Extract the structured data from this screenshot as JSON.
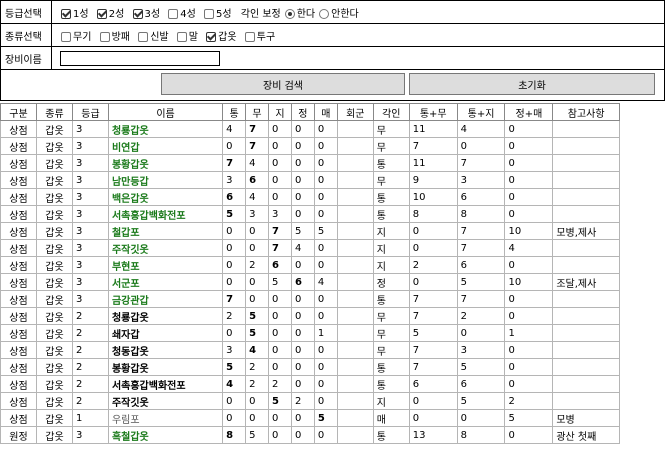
{
  "filters": {
    "grade": {
      "label": "등급선택",
      "options": [
        {
          "label": "1성",
          "checked": true
        },
        {
          "label": "2성",
          "checked": true
        },
        {
          "label": "3성",
          "checked": true
        },
        {
          "label": "4성",
          "checked": false
        },
        {
          "label": "5성",
          "checked": false
        }
      ],
      "engrave": {
        "label": "각인 보정",
        "options": [
          {
            "label": "한다",
            "selected": true
          },
          {
            "label": "안한다",
            "selected": false
          }
        ]
      }
    },
    "type": {
      "label": "종류선택",
      "options": [
        {
          "label": "무기",
          "checked": false
        },
        {
          "label": "방패",
          "checked": false
        },
        {
          "label": "신발",
          "checked": false
        },
        {
          "label": "말",
          "checked": false
        },
        {
          "label": "갑옷",
          "checked": true
        },
        {
          "label": "투구",
          "checked": false
        }
      ]
    },
    "name": {
      "label": "장비이름",
      "value": ""
    }
  },
  "buttons": {
    "search": "장비 검색",
    "reset": "초기화"
  },
  "table": {
    "headers": [
      "구분",
      "종류",
      "등급",
      "이름",
      "통",
      "무",
      "지",
      "정",
      "매",
      "회군",
      "각인",
      "통+무",
      "통+지",
      "정+매",
      "참고사항"
    ],
    "rows": [
      {
        "cells": [
          "상점",
          "갑옷",
          "3",
          "청룡갑옷",
          "4",
          "7",
          "0",
          "0",
          "0",
          "",
          "무",
          "11",
          "4",
          "0",
          ""
        ],
        "name_style": "green",
        "bold": [
          5
        ]
      },
      {
        "cells": [
          "상점",
          "갑옷",
          "3",
          "비연갑",
          "0",
          "7",
          "0",
          "0",
          "0",
          "",
          "무",
          "7",
          "0",
          "0",
          ""
        ],
        "name_style": "green",
        "bold": [
          5
        ]
      },
      {
        "cells": [
          "상점",
          "갑옷",
          "3",
          "봉황갑옷",
          "7",
          "4",
          "0",
          "0",
          "0",
          "",
          "통",
          "11",
          "7",
          "0",
          ""
        ],
        "name_style": "green",
        "bold": [
          4
        ]
      },
      {
        "cells": [
          "상점",
          "갑옷",
          "3",
          "남만등갑",
          "3",
          "6",
          "0",
          "0",
          "0",
          "",
          "무",
          "9",
          "3",
          "0",
          ""
        ],
        "name_style": "green",
        "bold": [
          5
        ]
      },
      {
        "cells": [
          "상점",
          "갑옷",
          "3",
          "백은갑옷",
          "6",
          "4",
          "0",
          "0",
          "0",
          "",
          "통",
          "10",
          "6",
          "0",
          ""
        ],
        "name_style": "green",
        "bold": [
          4
        ]
      },
      {
        "cells": [
          "상점",
          "갑옷",
          "3",
          "서촉홍갑백화전포",
          "5",
          "3",
          "3",
          "0",
          "0",
          "",
          "통",
          "8",
          "8",
          "0",
          ""
        ],
        "name_style": "green",
        "bold": [
          4
        ]
      },
      {
        "cells": [
          "상점",
          "갑옷",
          "3",
          "철갑포",
          "0",
          "0",
          "7",
          "5",
          "5",
          "",
          "지",
          "0",
          "7",
          "10",
          "모병,제사"
        ],
        "name_style": "green",
        "bold": [
          6
        ]
      },
      {
        "cells": [
          "상점",
          "갑옷",
          "3",
          "주작깃옷",
          "0",
          "0",
          "7",
          "4",
          "0",
          "",
          "지",
          "0",
          "7",
          "4",
          ""
        ],
        "name_style": "green",
        "bold": [
          6
        ]
      },
      {
        "cells": [
          "상점",
          "갑옷",
          "3",
          "부현포",
          "0",
          "2",
          "6",
          "0",
          "0",
          "",
          "지",
          "2",
          "6",
          "0",
          ""
        ],
        "name_style": "green",
        "bold": [
          6
        ]
      },
      {
        "cells": [
          "상점",
          "갑옷",
          "3",
          "서군포",
          "0",
          "0",
          "5",
          "6",
          "4",
          "",
          "정",
          "0",
          "5",
          "10",
          "조달,제사"
        ],
        "name_style": "green",
        "bold": [
          7
        ]
      },
      {
        "cells": [
          "상점",
          "갑옷",
          "3",
          "금강관갑",
          "7",
          "0",
          "0",
          "0",
          "0",
          "",
          "통",
          "7",
          "7",
          "0",
          ""
        ],
        "name_style": "green",
        "bold": [
          4
        ]
      },
      {
        "cells": [
          "상점",
          "갑옷",
          "2",
          "청룡갑옷",
          "2",
          "5",
          "0",
          "0",
          "0",
          "",
          "무",
          "7",
          "2",
          "0",
          ""
        ],
        "name_style": "bold",
        "bold": [
          5
        ]
      },
      {
        "cells": [
          "상점",
          "갑옷",
          "2",
          "쇄자갑",
          "0",
          "5",
          "0",
          "0",
          "1",
          "",
          "무",
          "5",
          "0",
          "1",
          ""
        ],
        "name_style": "bold",
        "bold": [
          5
        ]
      },
      {
        "cells": [
          "상점",
          "갑옷",
          "2",
          "청동갑옷",
          "3",
          "4",
          "0",
          "0",
          "0",
          "",
          "무",
          "7",
          "3",
          "0",
          ""
        ],
        "name_style": "bold",
        "bold": [
          5
        ]
      },
      {
        "cells": [
          "상점",
          "갑옷",
          "2",
          "봉황갑옷",
          "5",
          "2",
          "0",
          "0",
          "0",
          "",
          "통",
          "7",
          "5",
          "0",
          ""
        ],
        "name_style": "bold",
        "bold": [
          4
        ]
      },
      {
        "cells": [
          "상점",
          "갑옷",
          "2",
          "서촉홍갑백화전포",
          "4",
          "2",
          "2",
          "0",
          "0",
          "",
          "통",
          "6",
          "6",
          "0",
          ""
        ],
        "name_style": "bold",
        "bold": [
          4
        ]
      },
      {
        "cells": [
          "상점",
          "갑옷",
          "2",
          "주작깃옷",
          "0",
          "0",
          "5",
          "2",
          "0",
          "",
          "지",
          "0",
          "5",
          "2",
          ""
        ],
        "name_style": "bold",
        "bold": [
          6
        ]
      },
      {
        "cells": [
          "상점",
          "갑옷",
          "1",
          "우림포",
          "0",
          "0",
          "0",
          "0",
          "5",
          "",
          "매",
          "0",
          "0",
          "5",
          "모병"
        ],
        "name_style": "gray",
        "bold": [
          8
        ]
      },
      {
        "cells": [
          "원정",
          "갑옷",
          "3",
          "흑철갑옷",
          "8",
          "5",
          "0",
          "0",
          "0",
          "",
          "통",
          "13",
          "8",
          "0",
          "광산 첫째"
        ],
        "name_style": "green",
        "bold": [
          4
        ]
      }
    ]
  }
}
